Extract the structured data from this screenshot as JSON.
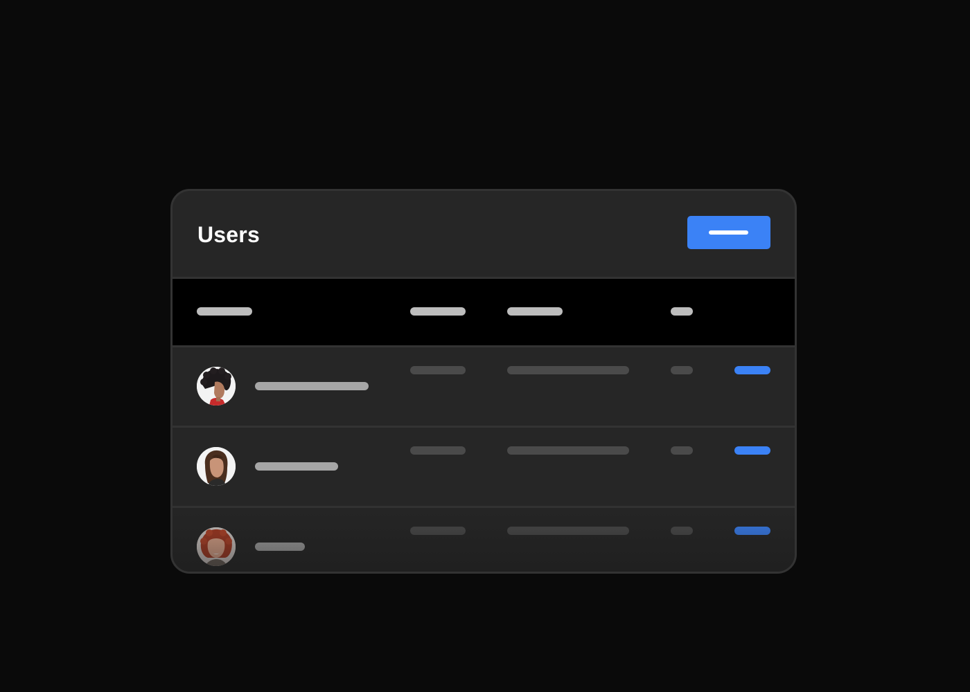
{
  "card": {
    "title": "Users"
  },
  "header_button": {
    "icon": "label-placeholder-icon"
  },
  "colors": {
    "background": "#0a0a0a",
    "card": "#262626",
    "table_header": "#000000",
    "accent": "#3b82f6",
    "border": "#333333"
  },
  "table": {
    "columns": [
      "name-column",
      "column-2",
      "column-3",
      "column-4",
      "actions-column"
    ],
    "rows": [
      {
        "avatar": "avatar-curly-hair-person"
      },
      {
        "avatar": "avatar-long-hair-person"
      },
      {
        "avatar": "avatar-red-hair-person"
      }
    ]
  }
}
